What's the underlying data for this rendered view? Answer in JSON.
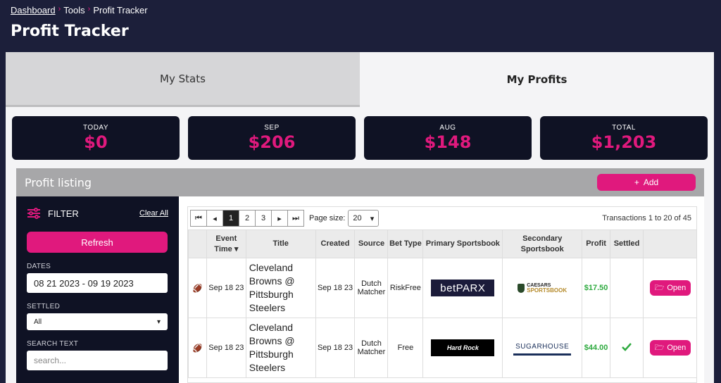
{
  "breadcrumb": {
    "home": "Dashboard",
    "section": "Tools",
    "current": "Profit Tracker"
  },
  "page_title": "Profit Tracker",
  "tabs": [
    {
      "label": "My Stats"
    },
    {
      "label": "My Profits"
    }
  ],
  "stats": [
    {
      "label": "TODAY",
      "value": "$0"
    },
    {
      "label": "SEP",
      "value": "$206"
    },
    {
      "label": "AUG",
      "value": "$148"
    },
    {
      "label": "TOTAL",
      "value": "$1,203"
    }
  ],
  "listing": {
    "title": "Profit listing",
    "add_label": "Add"
  },
  "filter": {
    "title": "FILTER",
    "clear_label": "Clear All",
    "refresh_label": "Refresh",
    "dates_label": "DATES",
    "dates_value": "08 21 2023 - 09 19 2023",
    "settled_label": "SETTLED",
    "settled_value": "All",
    "search_label": "SEARCH TEXT",
    "search_placeholder": "search..."
  },
  "pager": {
    "pages": [
      "1",
      "2",
      "3"
    ],
    "current": "1",
    "page_size_label": "Page size:",
    "page_size": "20",
    "info": "Transactions 1 to 20 of 45"
  },
  "table": {
    "headers": {
      "event_time": "Event Time",
      "title": "Title",
      "created": "Created",
      "source": "Source",
      "bet_type": "Bet Type",
      "primary": "Primary Sportsbook",
      "secondary": "Secondary Sportsbook",
      "profit": "Profit",
      "settled": "Settled"
    },
    "rows": [
      {
        "event_time": "Sep 18 23",
        "title": "Cleveland Browns @ Pittsburgh Steelers",
        "created": "Sep 18 23",
        "source": "Dutch Matcher",
        "bet_type": "RiskFree",
        "primary": "betPARX",
        "secondary": "SPORTSBOOK",
        "secondary_top": "CAESARS",
        "profit": "$17.50",
        "settled": false,
        "action": "Open"
      },
      {
        "event_time": "Sep 18 23",
        "title": "Cleveland Browns @ Pittsburgh Steelers",
        "created": "Sep 18 23",
        "source": "Dutch Matcher",
        "bet_type": "Free",
        "primary": "Hard Rock",
        "secondary": "SUGARHOUSE",
        "profit": "$44.00",
        "settled": true,
        "action": "Open"
      }
    ]
  },
  "colors": {
    "accent": "#e0197d",
    "dark": "#0f1224",
    "bg": "#1c1f3a",
    "profit": "#2eaa3f"
  }
}
